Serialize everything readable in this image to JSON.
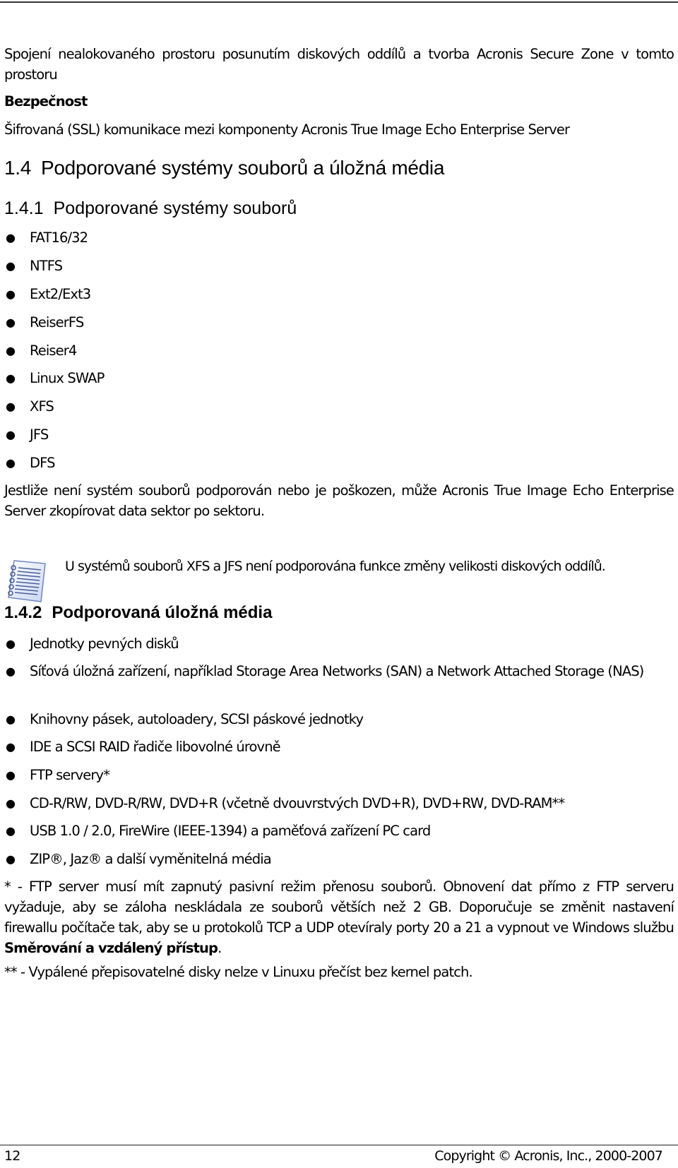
{
  "intro": {
    "feature_text": "Spojení nealokovaného prostoru posunutím diskových oddílů a tvorba Acronis Secure Zone v tomto prostoru",
    "security_heading": "Bezpečnost",
    "security_text": "Šifrovaná (SSL) komunikace mezi komponenty Acronis True Image Echo Enterprise Server"
  },
  "section_1_4": {
    "number": "1.4",
    "title": "Podporované systémy souborů a úložná média"
  },
  "section_1_4_1": {
    "number": "1.4.1",
    "title": "Podporované systémy souborů",
    "items": [
      "FAT16/32",
      "NTFS",
      "Ext2/Ext3",
      "ReiserFS",
      "Reiser4",
      "Linux SWAP",
      "XFS",
      "JFS",
      "DFS"
    ],
    "paragraph": "Jestliže není systém souborů podporován nebo je poškozen, může Acronis True Image Echo Enterprise Server zkopírovat data sektor po sektoru.",
    "note_icon": "notepad-icon",
    "note": "U systémů souborů XFS a JFS není podporována funkce změny velikosti diskových oddílů."
  },
  "section_1_4_2": {
    "number": "1.4.2",
    "title": "Podporovaná úložná média",
    "items": [
      "Jednotky pevných disků",
      "Síťová úložná zařízení, například Storage Area Networks (SAN) a Network Attached Storage (NAS)",
      "Knihovny pásek, autoloadery, SCSI páskové jednotky",
      "IDE a SCSI RAID řadiče libovolné úrovně",
      "FTP servery*",
      "CD-R/RW, DVD-R/RW, DVD+R (včetně dvouvrstvých DVD+R), DVD+RW, DVD-RAM**",
      "USB 1.0 / 2.0, FireWire (IEEE-1394) a paměťová zařízení PC card",
      "ZIP®, Jaz® a další vyměnitelná média"
    ],
    "footnote1_text": "* - FTP server musí mít zapnutý pasivní režim přenosu souborů. Obnovení dat přímo z FTP serveru vyžaduje, aby se záloha neskládala ze souborů větších než 2 GB. Doporučuje se změnit nastavení firewallu počítače tak, aby se u protokolů TCP a UDP otevíraly porty 20 a 21 a vypnout ve Windows službu ",
    "footnote1_bold": "Směrování a vzdálený přístup",
    "footnote1_end": ".",
    "footnote2": "** - Vypálené přepisovatelné disky nelze v Linuxu přečíst bez kernel patch."
  },
  "footer": {
    "page_number": "12",
    "copyright": "Copyright © Acronis, Inc., 2000-2007"
  }
}
